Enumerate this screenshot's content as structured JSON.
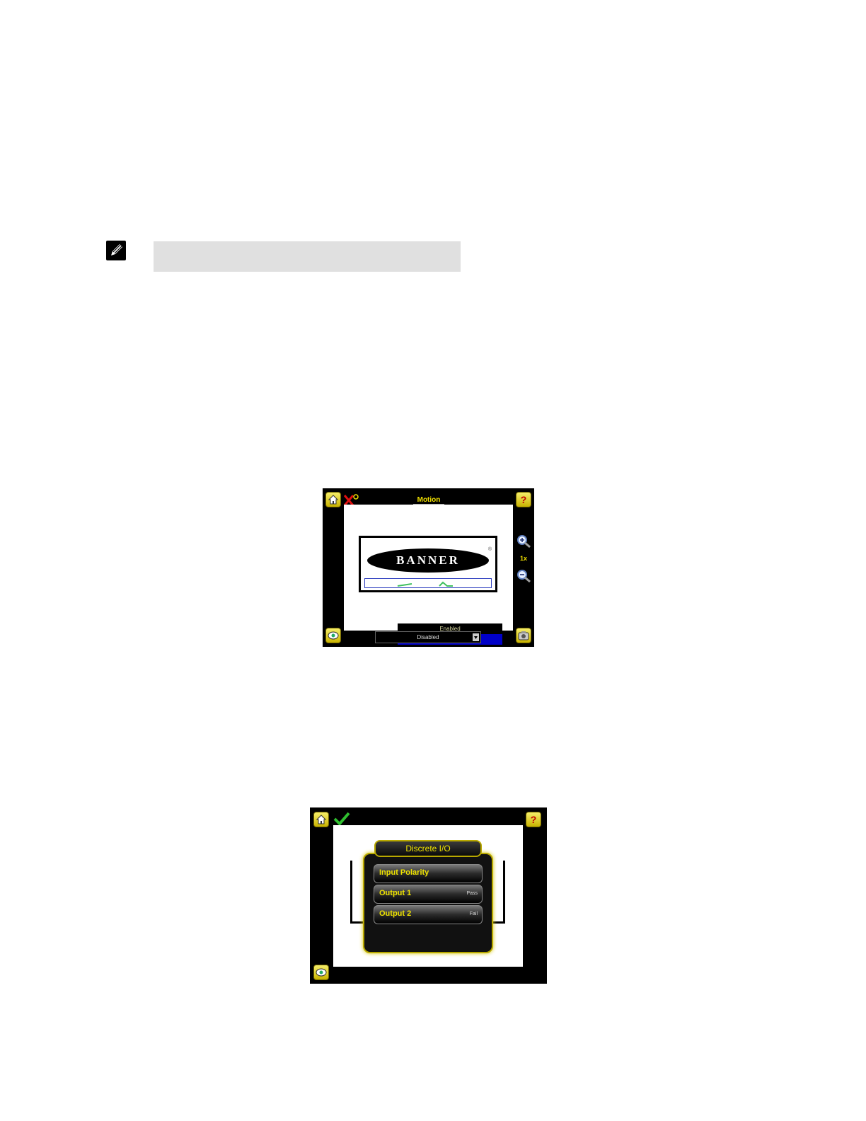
{
  "screen1": {
    "title": "Motion",
    "logo_text": "BANNER",
    "logo_reg": "®",
    "zoom_level": "1x",
    "dropdown": {
      "options": [
        "Enabled",
        "Disabled"
      ],
      "selected": "Disabled"
    }
  },
  "screen2": {
    "menu_title": "Discrete I/O",
    "items": [
      {
        "label": "Input Polarity",
        "value": ""
      },
      {
        "label": "Output 1",
        "value": "Pass"
      },
      {
        "label": "Output 2",
        "value": "Fail"
      }
    ]
  }
}
